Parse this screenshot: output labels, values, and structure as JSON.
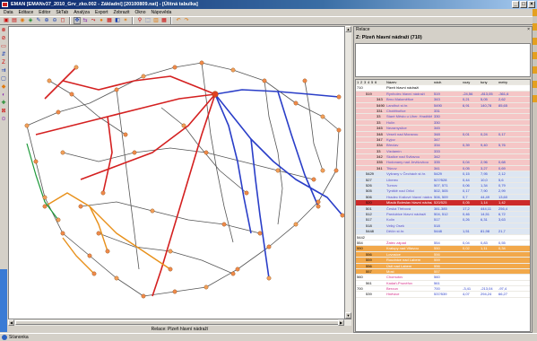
{
  "window": {
    "title": "EMAN   [EMANv37_2010_Grv_zko.002 - Základní] [20100809.nat] - [Úlitná tabulka]",
    "controls": [
      "_",
      "□",
      "×"
    ]
  },
  "menu": [
    "Data",
    "Editace",
    "Editor",
    "SkTab",
    "Analýza",
    "Export",
    "Zobrazit",
    "Okno",
    "Nápověda"
  ],
  "toolbar": {
    "icons": [
      {
        "name": "open-icon",
        "glyph": "▣",
        "color": "red"
      },
      {
        "name": "save-icon",
        "glyph": "▤",
        "color": "red"
      },
      {
        "name": "print-icon",
        "glyph": "◉",
        "color": "orange"
      },
      {
        "name": "folder-icon",
        "glyph": "◈",
        "color": "green"
      },
      {
        "name": "edit-icon",
        "glyph": "✎",
        "color": "blue"
      },
      {
        "name": "zoom-in-icon",
        "glyph": "⊕",
        "color": "blue"
      },
      {
        "name": "zoom-out-icon",
        "glyph": "⊖",
        "color": "blue"
      },
      {
        "name": "zoom-box-icon",
        "glyph": "◻",
        "color": "red"
      },
      {
        "name": "pan-icon",
        "glyph": "✥",
        "color": "blue"
      },
      {
        "name": "measure-icon",
        "glyph": "⇆",
        "color": "purple"
      },
      {
        "name": "route-icon",
        "glyph": "⤳",
        "color": "red"
      },
      {
        "name": "node-icon",
        "glyph": "●",
        "color": "orange"
      },
      {
        "name": "grid-icon",
        "glyph": "▦",
        "color": "red"
      },
      {
        "name": "layers-icon",
        "glyph": "◧",
        "color": "blue"
      },
      {
        "name": "star-icon",
        "glyph": "✶",
        "color": "orange"
      },
      {
        "name": "filter-icon",
        "glyph": "⚲",
        "color": "red"
      },
      {
        "name": "select-icon",
        "glyph": "⬚",
        "color": "blue"
      },
      {
        "name": "chart-icon",
        "glyph": "▥",
        "color": "orange"
      },
      {
        "name": "table-icon",
        "glyph": "▦",
        "color": "red"
      },
      {
        "name": "undo-icon",
        "glyph": "↶",
        "color": "orange"
      },
      {
        "name": "redo-icon",
        "glyph": "↷",
        "color": "orange"
      }
    ]
  },
  "left_tools": [
    "⊗",
    "⊘",
    "▭",
    "⇵",
    "Z",
    "⇉",
    "▢",
    "◆",
    "◐",
    "✚",
    "⊠",
    "⊙"
  ],
  "map": {
    "status": "Relace: Plzeň hlavní nádraží",
    "colors": {
      "red": "#d42020",
      "blue": "#2a3ec8",
      "orange": "#e8901a",
      "green": "#1e9a3a",
      "gray": "#555555"
    }
  },
  "panel": {
    "header": "Relace",
    "title": "Z: Plzeň hlavní nádraží (710)",
    "tabs": [
      "1",
      "2",
      "3",
      "4",
      "5",
      "6"
    ],
    "columns": [
      "",
      "",
      "",
      "Název",
      "nádr.",
      "vozy",
      "tuny",
      "metry"
    ],
    "rows": [
      {
        "c": [
          "710",
          "",
          "",
          "Plzeň hlavní nádraží",
          "",
          "",
          "",
          ""
        ],
        "bg": "#ffffff",
        "fg": "#000000"
      },
      {
        "c": [
          "",
          "519",
          "",
          "Rynholec hlavní nádraží",
          "519",
          "-24,56",
          "-813,05",
          "-361,6"
        ],
        "bg": "#f5c6c6",
        "fg": "#5a50c8"
      },
      {
        "c": [
          "",
          "",
          "343",
          "Brno Maloměřice",
          "343",
          "0,21",
          "5,05",
          "2,62"
        ],
        "bg": "#f5c6c6",
        "fg": "#5a50c8"
      },
      {
        "c": [
          "",
          "",
          "5490",
          "Landhut st.hr.",
          "5490",
          "6,91",
          "140,78",
          "85,65"
        ],
        "bg": "#f5c6c6",
        "fg": "#5a50c8"
      },
      {
        "c": [
          "",
          "",
          "331",
          "Chotěbořice",
          "331",
          "",
          "",
          ""
        ],
        "bg": "#f5c6c6",
        "fg": "#5a50c8"
      },
      {
        "c": [
          "",
          "",
          "33",
          "Staré Město u Uher. Hradiště",
          "330",
          "",
          "",
          ""
        ],
        "bg": "#f5c6c6",
        "fg": "#5a50c8"
      },
      {
        "c": [
          "",
          "",
          "33",
          "Hulín",
          "330",
          "",
          "",
          ""
        ],
        "bg": "#f5c6c6",
        "fg": "#5a50c8"
      },
      {
        "c": [
          "",
          "",
          "345",
          "Nezamyslice",
          "345",
          "",
          "",
          ""
        ],
        "bg": "#f5c6c6",
        "fg": "#5a50c8"
      },
      {
        "c": [
          "",
          "",
          "348",
          "Veselí nad Moravou",
          "348",
          "0,01",
          "0,24",
          "0,17"
        ],
        "bg": "#f5c6c6",
        "fg": "#5a50c8"
      },
      {
        "c": [
          "",
          "",
          "347",
          "Kyjov",
          "347",
          "",
          "",
          ""
        ],
        "bg": "#f5c6c6",
        "fg": "#5a50c8"
      },
      {
        "c": [
          "",
          "",
          "334",
          "Břeclav",
          "334",
          "0,39",
          "9,40",
          "5,76"
        ],
        "bg": "#f5c6c6",
        "fg": "#5a50c8"
      },
      {
        "c": [
          "",
          "",
          "33",
          "Vizdamín",
          "333",
          "",
          "",
          ""
        ],
        "bg": "#f5c6c6",
        "fg": "#5a50c8"
      },
      {
        "c": [
          "",
          "",
          "342",
          "Skalice nad Svitavou",
          "342",
          "",
          "",
          ""
        ],
        "bg": "#f5c6c6",
        "fg": "#5a50c8"
      },
      {
        "c": [
          "",
          "",
          "335",
          "Hodonany nad Jevišovkou",
          "335",
          "0,04",
          "2,96",
          "0,68"
        ],
        "bg": "#f5c6c6",
        "fg": "#5a50c8"
      },
      {
        "c": [
          "",
          "",
          "341",
          "Tišnov",
          "341",
          "0,05",
          "3,27",
          "0,69"
        ],
        "bg": "#f5c6c6",
        "fg": "#5a50c8"
      },
      {
        "c": [
          "",
          "5429",
          "",
          "Vyšrany v Čechách st.hr.",
          "5429",
          "0,15",
          "7,95",
          "2,12"
        ],
        "bg": "#dde6f2",
        "fg": "#5a50c8"
      },
      {
        "c": [
          "",
          "527",
          "",
          "Liberec",
          "527/528",
          "0,44",
          "10,0",
          "5,6"
        ],
        "bg": "#dde6f2",
        "fg": "#5a50c8"
      },
      {
        "c": [
          "",
          "526",
          "",
          "Turnov",
          "507, 571",
          "0,06",
          "1,34",
          "0,79"
        ],
        "bg": "#dde6f2",
        "fg": "#5a50c8"
      },
      {
        "c": [
          "",
          "505",
          "",
          "Týniště nad Orlicí",
          "502, 505",
          "0,17",
          "7,90",
          "2,99"
        ],
        "bg": "#dde6f2",
        "fg": "#5a50c8"
      },
      {
        "c": [
          "",
          "506",
          "",
          "Hradec Králové hlavní nádraží",
          "506, 509",
          "0,7",
          "44,49",
          "13,60"
        ],
        "bg": "#dde6f2",
        "fg": "#5a50c8"
      },
      {
        "c": [
          "",
          "520",
          "",
          "Mladá Boleslav hlavní nádraží",
          "520/525",
          "0,05",
          "1,14",
          "1,42"
        ],
        "bg": "#cc2a2a",
        "fg": "#ffffff"
      },
      {
        "c": [
          "",
          "501",
          "",
          "Česká Třebová",
          "381-385",
          "17,2",
          "444,11",
          "256,4"
        ],
        "bg": "#dde6f2",
        "fg": "#5a50c8"
      },
      {
        "c": [
          "",
          "512",
          "",
          "Pardubice hlavní nádraží",
          "504, 512",
          "0,46",
          "14,51",
          "6,72"
        ],
        "bg": "#dde6f2",
        "fg": "#5a50c8"
      },
      {
        "c": [
          "",
          "517",
          "",
          "Kolín",
          "517",
          "0,26",
          "6,31",
          "3,63"
        ],
        "bg": "#dde6f2",
        "fg": "#5a50c8"
      },
      {
        "c": [
          "",
          "518",
          "",
          "Velký Osek",
          "518",
          "",
          "",
          ""
        ],
        "bg": "#dde6f2",
        "fg": "#5a50c8"
      },
      {
        "c": [
          "",
          "5448",
          "",
          "Děčín st.hr.",
          "5448",
          "1,51",
          "81,98",
          "21,7"
        ],
        "bg": "#dde6f2",
        "fg": "#5a50c8"
      },
      {
        "c": [
          "5442",
          "",
          "",
          "",
          "",
          "",
          "",
          ""
        ],
        "bg": "#ffffff",
        "fg": "#000000"
      },
      {
        "c": [
          "554",
          "",
          "",
          "Žatec západ",
          "554",
          "0,04",
          "0,83",
          "0,55"
        ],
        "bg": "#ffffff",
        "fg": "#d6308a"
      },
      {
        "c": [
          "550",
          "",
          "",
          "Kralupy nad Vltavou",
          "550",
          "0,02",
          "1,11",
          "0,34"
        ],
        "bg": "#f2a84a",
        "fg": "#ffffff"
      },
      {
        "c": [
          "",
          "556",
          "",
          "Lovosice",
          "556",
          "",
          "",
          ""
        ],
        "bg": "#f2a84a",
        "fg": "#ffffff"
      },
      {
        "c": [
          "",
          "559",
          "",
          "Roudnice nad Labem",
          "559",
          "",
          "",
          ""
        ],
        "bg": "#f2a84a",
        "fg": "#ffffff"
      },
      {
        "c": [
          "",
          "556",
          "",
          "Ústí nad Labem",
          "556",
          "",
          "",
          ""
        ],
        "bg": "#f2a84a",
        "fg": "#ffffff"
      },
      {
        "c": [
          "",
          "557",
          "",
          "Most",
          "557",
          "",
          "",
          ""
        ],
        "bg": "#f2a84a",
        "fg": "#ffffff"
      },
      {
        "c": [
          "560",
          "",
          "",
          "Chomutov",
          "560",
          "",
          "",
          ""
        ],
        "bg": "#ffffff",
        "fg": "#d6308a"
      },
      {
        "c": [
          "",
          "561",
          "",
          "Kadaň-Prunéřov",
          "561",
          "",
          "",
          ""
        ],
        "bg": "#ffffff",
        "fg": "#d6308a"
      },
      {
        "c": [
          "700",
          "",
          "",
          "Beroun",
          "700",
          "-3,41",
          "-213,04",
          "-97,4"
        ],
        "bg": "#ffffff",
        "fg": "#d6308a"
      },
      {
        "c": [
          "",
          "539",
          "",
          "Hněvice",
          "537/539",
          "4,07",
          "294,24",
          "66,27"
        ],
        "bg": "#ffffff",
        "fg": "#d6308a"
      }
    ]
  },
  "statusbar": {
    "text": "Sťanonka"
  }
}
